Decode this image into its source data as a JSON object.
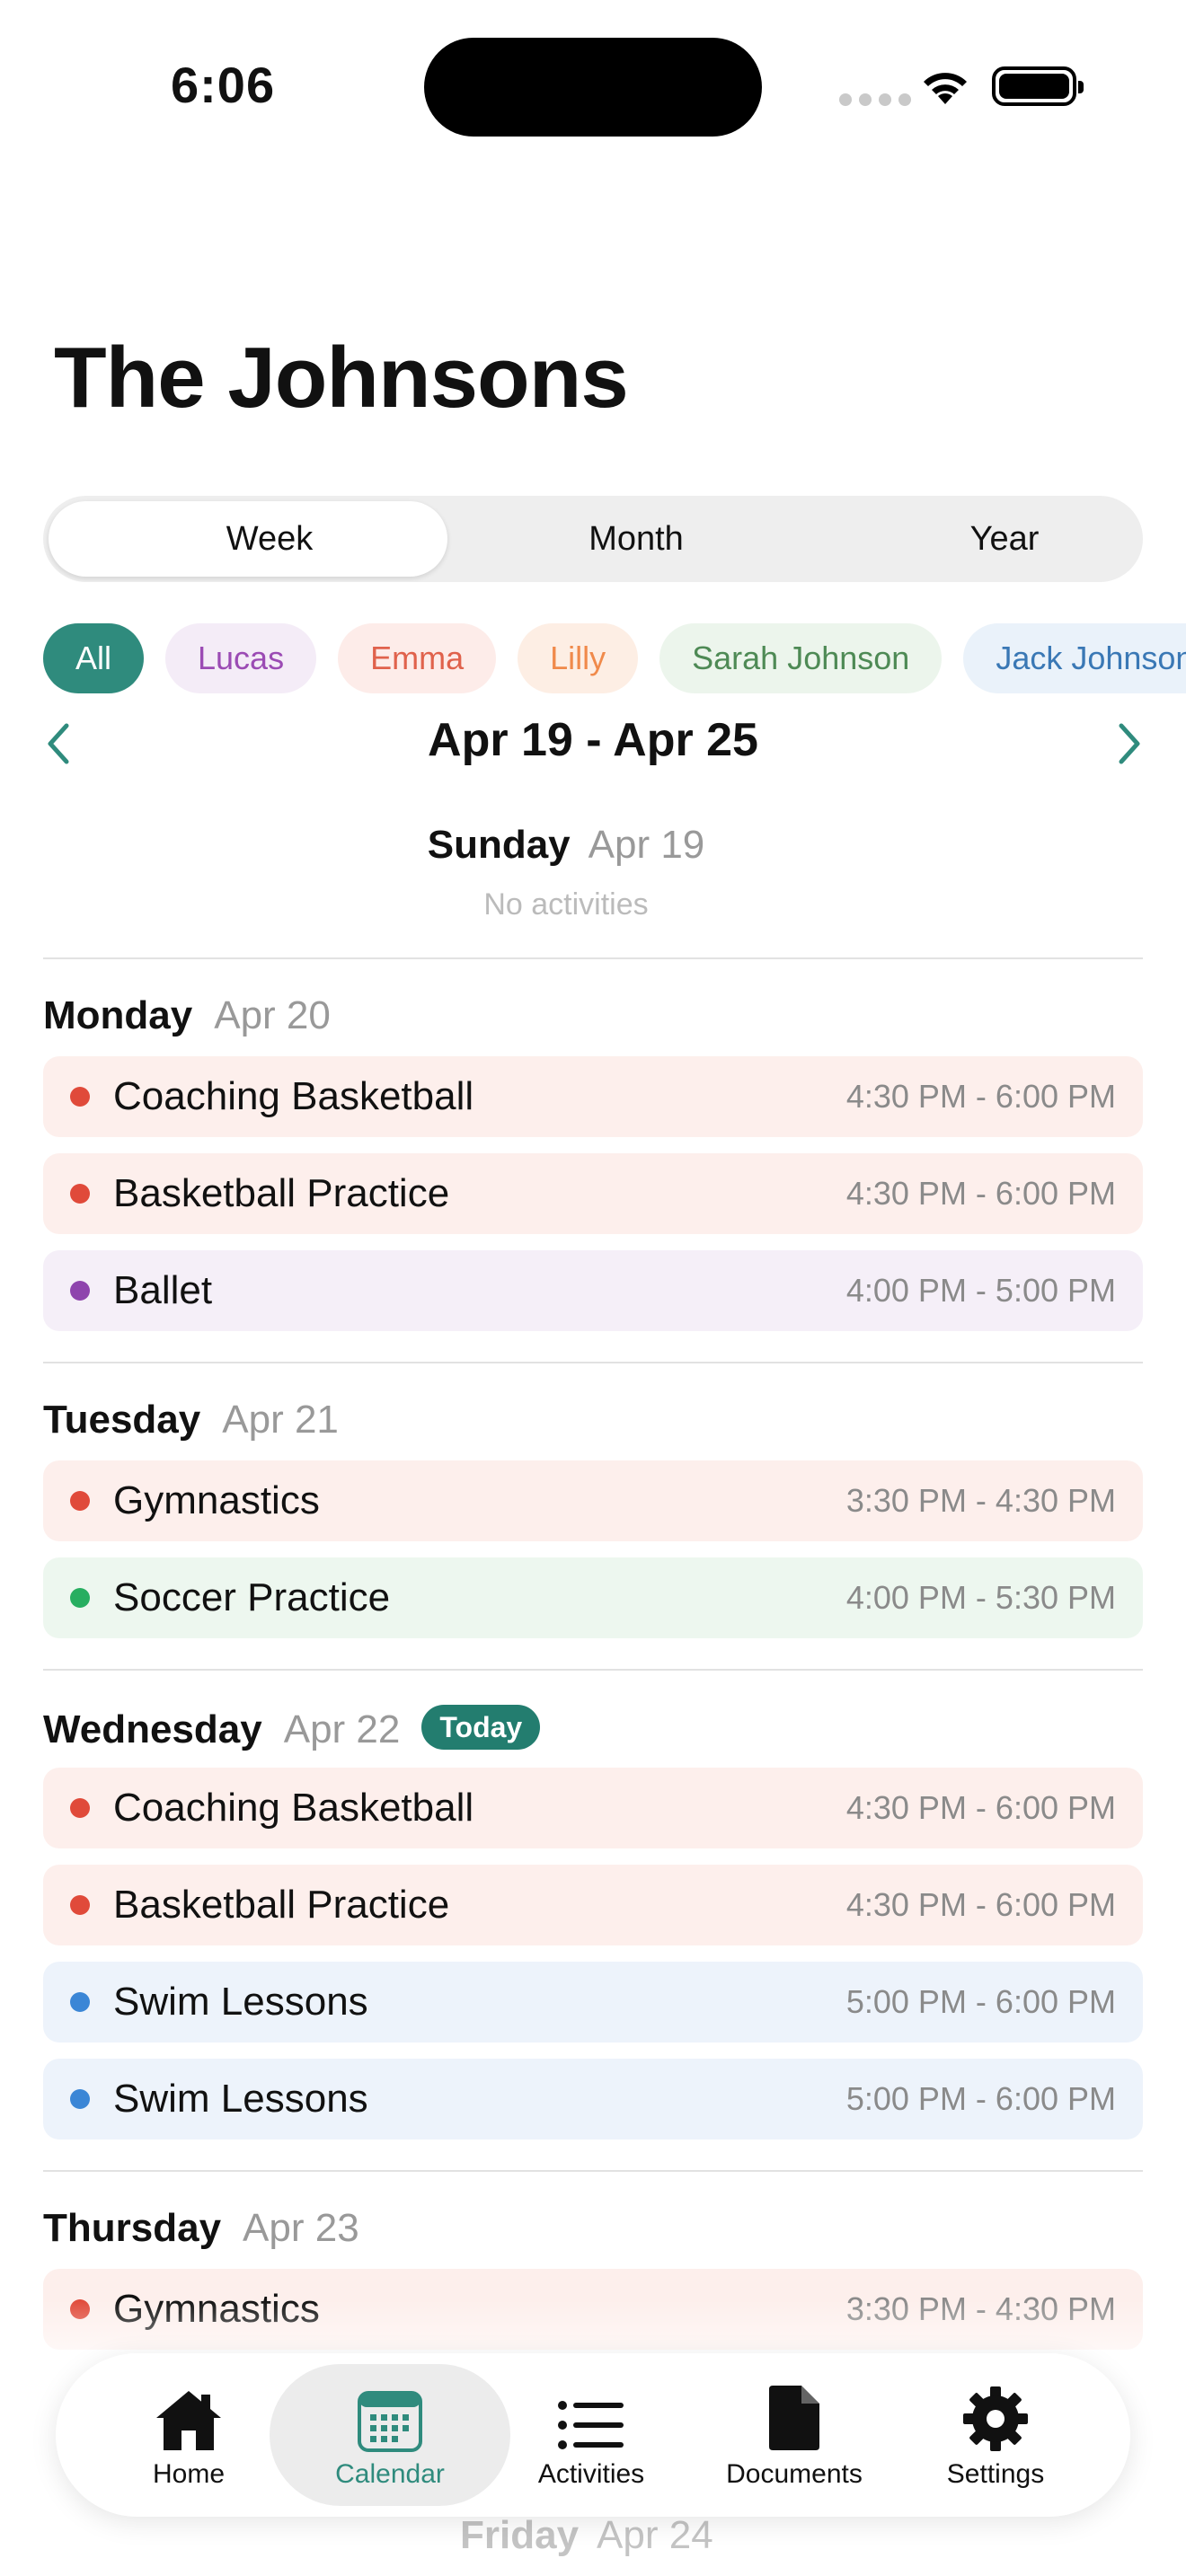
{
  "status": {
    "time": "6:06"
  },
  "header": {
    "title": "The Johnsons"
  },
  "segmented": {
    "items": [
      "Week",
      "Month",
      "Year"
    ],
    "selected": "Week"
  },
  "filters": [
    {
      "label": "All",
      "bg": "#2f8b7d",
      "fg": "#ffffff"
    },
    {
      "label": "Lucas",
      "bg": "#f4ecf7",
      "fg": "#9b4bb4"
    },
    {
      "label": "Emma",
      "bg": "#fdece9",
      "fg": "#e0624c"
    },
    {
      "label": "Lilly",
      "bg": "#fdeee4",
      "fg": "#f08a4b"
    },
    {
      "label": "Sarah Johnson",
      "bg": "#ecf5ec",
      "fg": "#4e8a55"
    },
    {
      "label": "Jack  Johnson",
      "bg": "#eaf2fa",
      "fg": "#3a78b5"
    }
  ],
  "week": {
    "range": "Apr 19 - Apr 25"
  },
  "sunday": {
    "day": "Sunday",
    "date": "Apr 19",
    "empty": "No activities"
  },
  "days": [
    {
      "day": "Monday",
      "date": "Apr 20",
      "activities": [
        {
          "name": "Coaching Basketball",
          "time": "4:30 PM - 6:00 PM",
          "dot": "#e04a3a",
          "bg": "#fdefec"
        },
        {
          "name": "Basketball Practice",
          "time": "4:30 PM - 6:00 PM",
          "dot": "#e04a3a",
          "bg": "#fdefec"
        },
        {
          "name": "Ballet",
          "time": "4:00 PM - 5:00 PM",
          "dot": "#8e44ad",
          "bg": "#f5eff8"
        }
      ]
    },
    {
      "day": "Tuesday",
      "date": "Apr 21",
      "activities": [
        {
          "name": "Gymnastics",
          "time": "3:30 PM - 4:30 PM",
          "dot": "#e04a3a",
          "bg": "#fdefec"
        },
        {
          "name": "Soccer Practice",
          "time": "4:00 PM - 5:30 PM",
          "dot": "#27ae60",
          "bg": "#edf7ef"
        }
      ]
    },
    {
      "day": "Wednesday",
      "date": "Apr 22",
      "badge": "Today",
      "activities": [
        {
          "name": "Coaching Basketball",
          "time": "4:30 PM - 6:00 PM",
          "dot": "#e04a3a",
          "bg": "#fdefec"
        },
        {
          "name": "Basketball Practice",
          "time": "4:30 PM - 6:00 PM",
          "dot": "#e04a3a",
          "bg": "#fdefec"
        },
        {
          "name": "Swim Lessons",
          "time": "5:00 PM - 6:00 PM",
          "dot": "#3b86d6",
          "bg": "#edf3fb"
        },
        {
          "name": "Swim Lessons",
          "time": "5:00 PM - 6:00 PM",
          "dot": "#3b86d6",
          "bg": "#edf3fb"
        }
      ]
    },
    {
      "day": "Thursday",
      "date": "Apr 23",
      "activities": [
        {
          "name": "Gymnastics",
          "time": "3:30 PM - 4:30 PM",
          "dot": "#e04a3a",
          "bg": "#fdefec"
        }
      ]
    }
  ],
  "friday": {
    "day": "Friday",
    "date": "Apr 24"
  },
  "tabs": [
    {
      "label": "Home",
      "icon": "house-icon"
    },
    {
      "label": "Calendar",
      "icon": "calendar-icon",
      "active": true
    },
    {
      "label": "Activities",
      "icon": "list-icon"
    },
    {
      "label": "Documents",
      "icon": "document-icon"
    },
    {
      "label": "Settings",
      "icon": "gear-icon"
    }
  ],
  "colors": {
    "accent": "#237d6f",
    "calendarActive": "#2f8b7d"
  }
}
